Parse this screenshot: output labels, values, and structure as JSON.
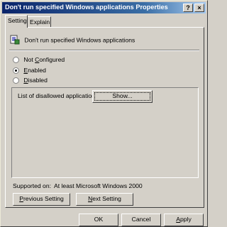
{
  "window": {
    "title": "Don't run specified Windows applications Properties"
  },
  "titlebar_buttons": {
    "help": "?",
    "close": "×"
  },
  "tabs": [
    {
      "label": "Setting"
    },
    {
      "label": "Explain"
    }
  ],
  "policy": {
    "name": "Don't run specified Windows applications",
    "icon": "policy-setting-icon"
  },
  "options": [
    {
      "label": "Not Configured",
      "selected": false
    },
    {
      "label": "Enabled",
      "selected": true
    },
    {
      "label": "Disabled",
      "selected": false
    }
  ],
  "list": {
    "label": "List of disallowed applications",
    "show_button": "Show..."
  },
  "supported": {
    "label": "Supported on:",
    "value": "At least Microsoft Windows 2000"
  },
  "nav": {
    "previous": "Previous Setting",
    "next": "Next Setting"
  },
  "footer": {
    "ok": "OK",
    "cancel": "Cancel",
    "apply": "Apply"
  }
}
